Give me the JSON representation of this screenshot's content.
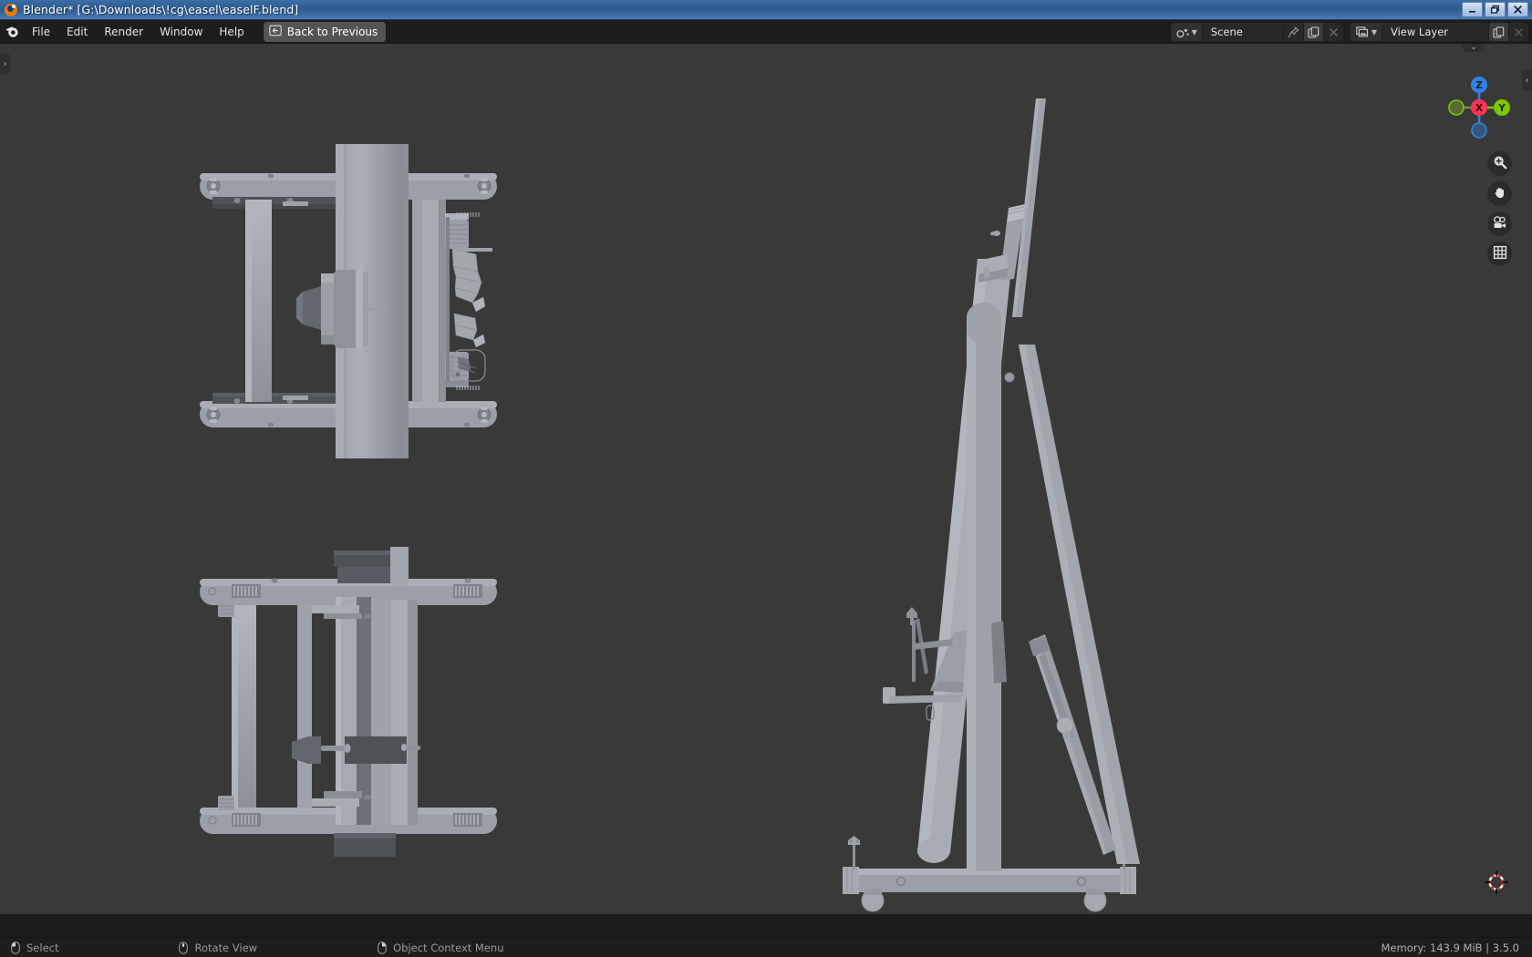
{
  "window": {
    "title": "Blender* [G:\\Downloads\\!cg\\easel\\easelF.blend]",
    "minimize_label": "Minimize",
    "restore_label": "Restore",
    "close_label": "Close",
    "titlebar_color": "#32609a"
  },
  "topbar": {
    "app_icon": "blender-logo-icon",
    "menus": [
      {
        "label": "File"
      },
      {
        "label": "Edit"
      },
      {
        "label": "Render"
      },
      {
        "label": "Window"
      },
      {
        "label": "Help"
      }
    ],
    "back_button": {
      "label": "Back to Previous",
      "icon": "back-to-previous-icon"
    },
    "scene": {
      "icon": "scene-icon",
      "name": "Scene",
      "pin_icon": "pin-icon",
      "new_icon": "new-scene-icon",
      "remove_icon": "remove-scene-icon"
    },
    "view_layer": {
      "icon": "view-layer-icon",
      "name": "View Layer",
      "new_icon": "new-view-layer-icon",
      "remove_icon": "remove-view-layer-icon"
    }
  },
  "viewport": {
    "background_color": "#393939",
    "model_light": "#a9adb4",
    "model_mid": "#8f939a",
    "model_dark": "#6e7279",
    "model_shadow": "#4a4d52",
    "gizmo": {
      "axes": [
        {
          "name": "Z",
          "label": "Z",
          "color": "#2f83e3",
          "positive": true
        },
        {
          "name": "X",
          "label": "X",
          "color": "#fc3556",
          "positive": true
        },
        {
          "name": "Y",
          "label": "Y",
          "color": "#7bc800",
          "positive": true
        },
        {
          "name": "-Z",
          "label": "",
          "color": "#2f83e3",
          "positive": false
        },
        {
          "name": "-X",
          "label": "",
          "color": "#7a8a3b",
          "positive": false
        },
        {
          "name": "-Y",
          "label": "",
          "color": "#7a8a3b",
          "positive": false
        }
      ]
    },
    "tools": [
      {
        "name": "zoom-view",
        "icon": "magnifier-plus-icon"
      },
      {
        "name": "move-view",
        "icon": "hand-icon"
      },
      {
        "name": "camera-view",
        "icon": "camera-icon"
      },
      {
        "name": "toggle-projection",
        "icon": "grid-icon"
      }
    ],
    "region_toggles": {
      "left": "›",
      "right": "‹",
      "top": "⌄"
    },
    "cursor_3d": "3d-cursor-icon"
  },
  "statusbar": {
    "hints": [
      {
        "icon": "mouse-left-icon",
        "label": "Select"
      },
      {
        "icon": "mouse-middle-icon",
        "label": "Rotate View"
      },
      {
        "icon": "mouse-right-icon",
        "label": "Object Context Menu"
      }
    ],
    "info": "Memory: 143.9 MiB | 3.5.0"
  }
}
